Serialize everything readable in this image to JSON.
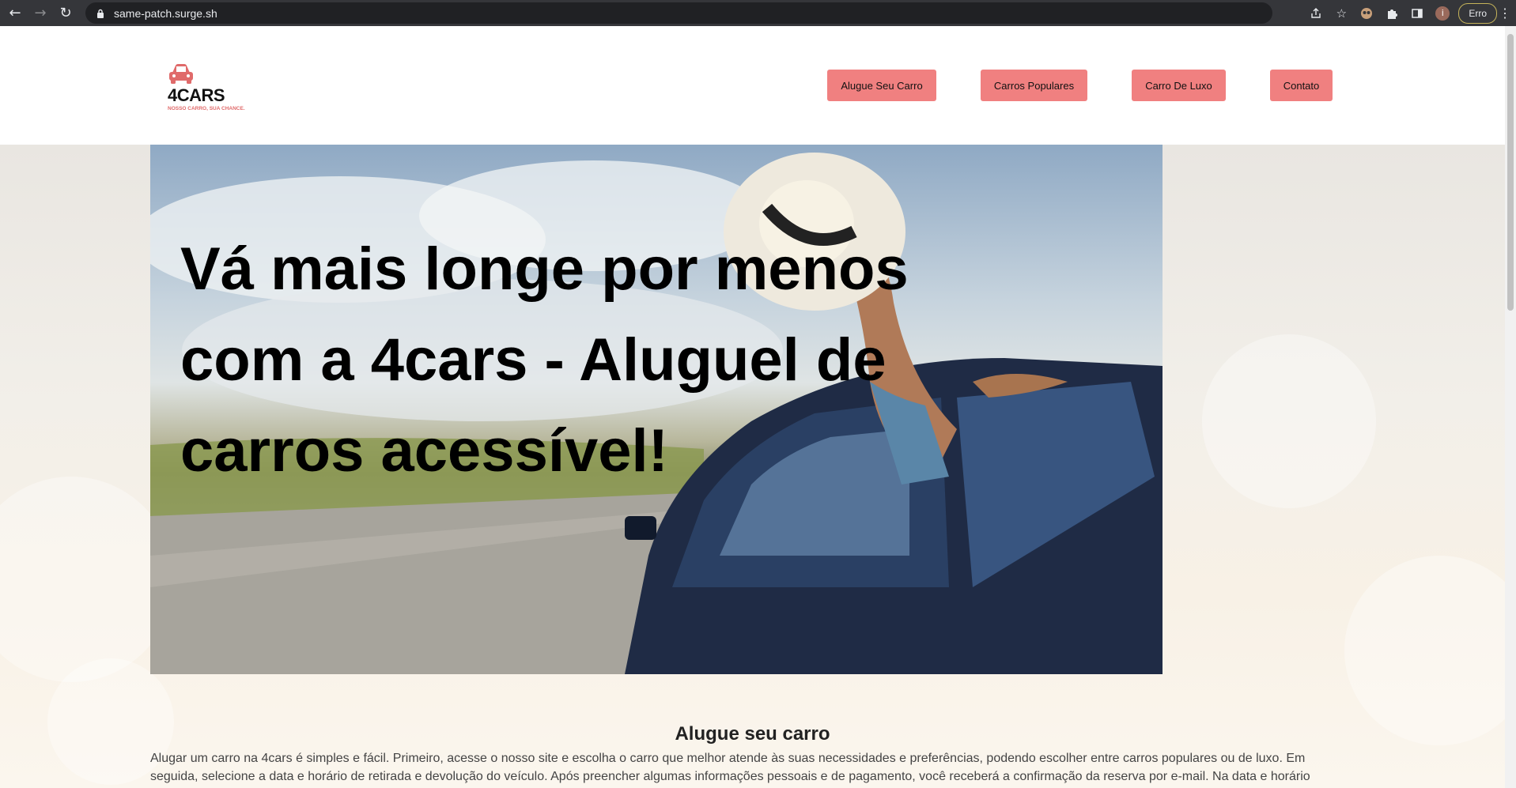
{
  "browser": {
    "url": "same-patch.surge.sh",
    "profile_initial": "i",
    "error_badge": "Erro"
  },
  "site": {
    "logo": {
      "name": "4CARS",
      "tagline": "NOSSO CARRO, SUA CHANCE."
    },
    "nav": [
      {
        "label": "Alugue Seu Carro"
      },
      {
        "label": "Carros Populares"
      },
      {
        "label": "Carro De Luxo"
      },
      {
        "label": "Contato"
      }
    ],
    "hero": {
      "title": "Vá mais longe por menos com a 4cars - Aluguel de carros acessível!"
    },
    "section": {
      "title": "Alugue seu carro",
      "body": "Alugar um carro na 4cars é simples e fácil. Primeiro, acesse o nosso site e escolha o carro que melhor atende às suas necessidades e preferências, podendo escolher entre carros populares ou de luxo. Em seguida, selecione a data e horário de retirada e devolução do veículo. Após preencher algumas informações pessoais e de pagamento, você receberá a confirmação da reserva por e-mail. Na data e horário"
    }
  },
  "colors": {
    "nav_button_bg": "#f08080",
    "brand_accent": "#e06a6a",
    "chrome_bg": "#35363a"
  },
  "icons": [
    "back-arrow-icon",
    "forward-arrow-icon",
    "reload-icon",
    "lock-icon",
    "share-icon",
    "star-icon",
    "extension-avatar-icon",
    "puzzle-icon",
    "side-panel-icon",
    "menu-kebab-icon",
    "car-logo-icon"
  ]
}
